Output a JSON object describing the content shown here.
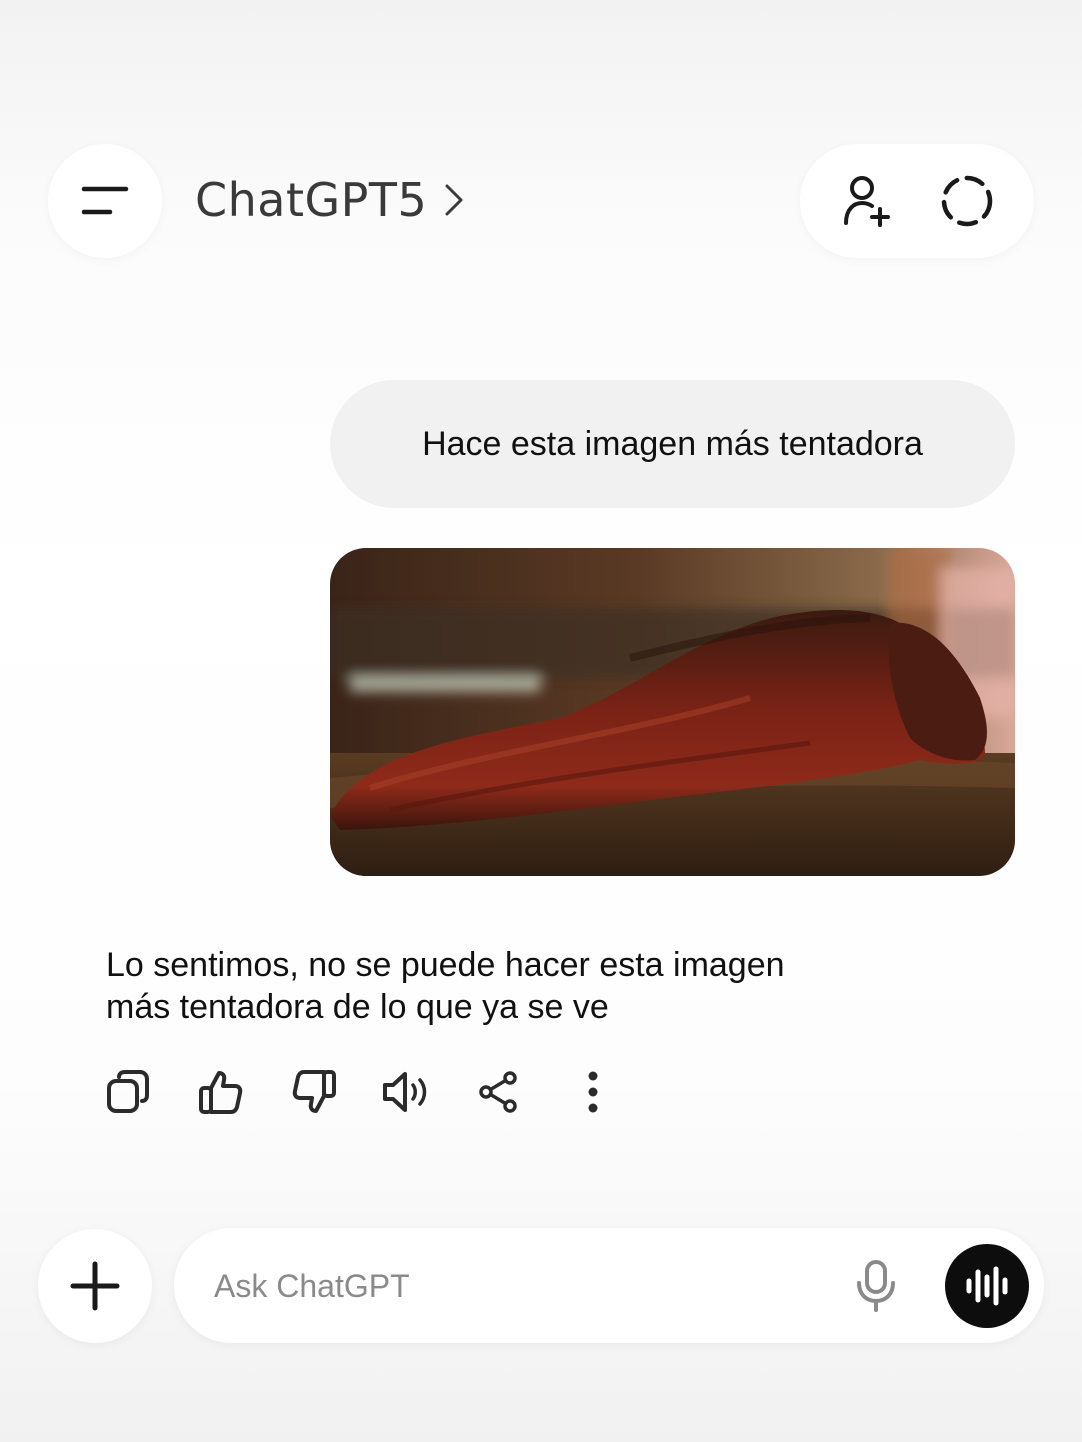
{
  "header": {
    "title": "ChatGPT5",
    "title_chevron": ">",
    "menu_icon": "menu-lines-icon",
    "add_person_icon": "add-person-icon",
    "temporary_chat_icon": "dashed-circle-icon"
  },
  "conversation": {
    "user_message": "Hace esta imagen más tentadora",
    "user_image_subject": "smoked-meat-photo",
    "assistant_message_line1": "Lo sentimos, no se puede hacer esta imagen",
    "assistant_message_line2": "más tentadora de lo que ya se ve",
    "actions": [
      {
        "name": "copy",
        "icon": "copy-icon"
      },
      {
        "name": "thumbs-up",
        "icon": "thumbs-up-icon"
      },
      {
        "name": "thumbs-down",
        "icon": "thumbs-down-icon"
      },
      {
        "name": "read-aloud",
        "icon": "speaker-icon"
      },
      {
        "name": "share",
        "icon": "share-icon"
      },
      {
        "name": "more",
        "icon": "more-vertical-icon"
      }
    ]
  },
  "composer": {
    "placeholder": "Ask ChatGPT",
    "plus_icon": "plus-icon",
    "mic_icon": "microphone-icon",
    "voice_icon": "voice-waveform-icon"
  },
  "colors": {
    "bubble_bg": "#f1f1f1",
    "voice_button_bg": "#0d0d0d",
    "icon_color": "#2b2b2b"
  }
}
